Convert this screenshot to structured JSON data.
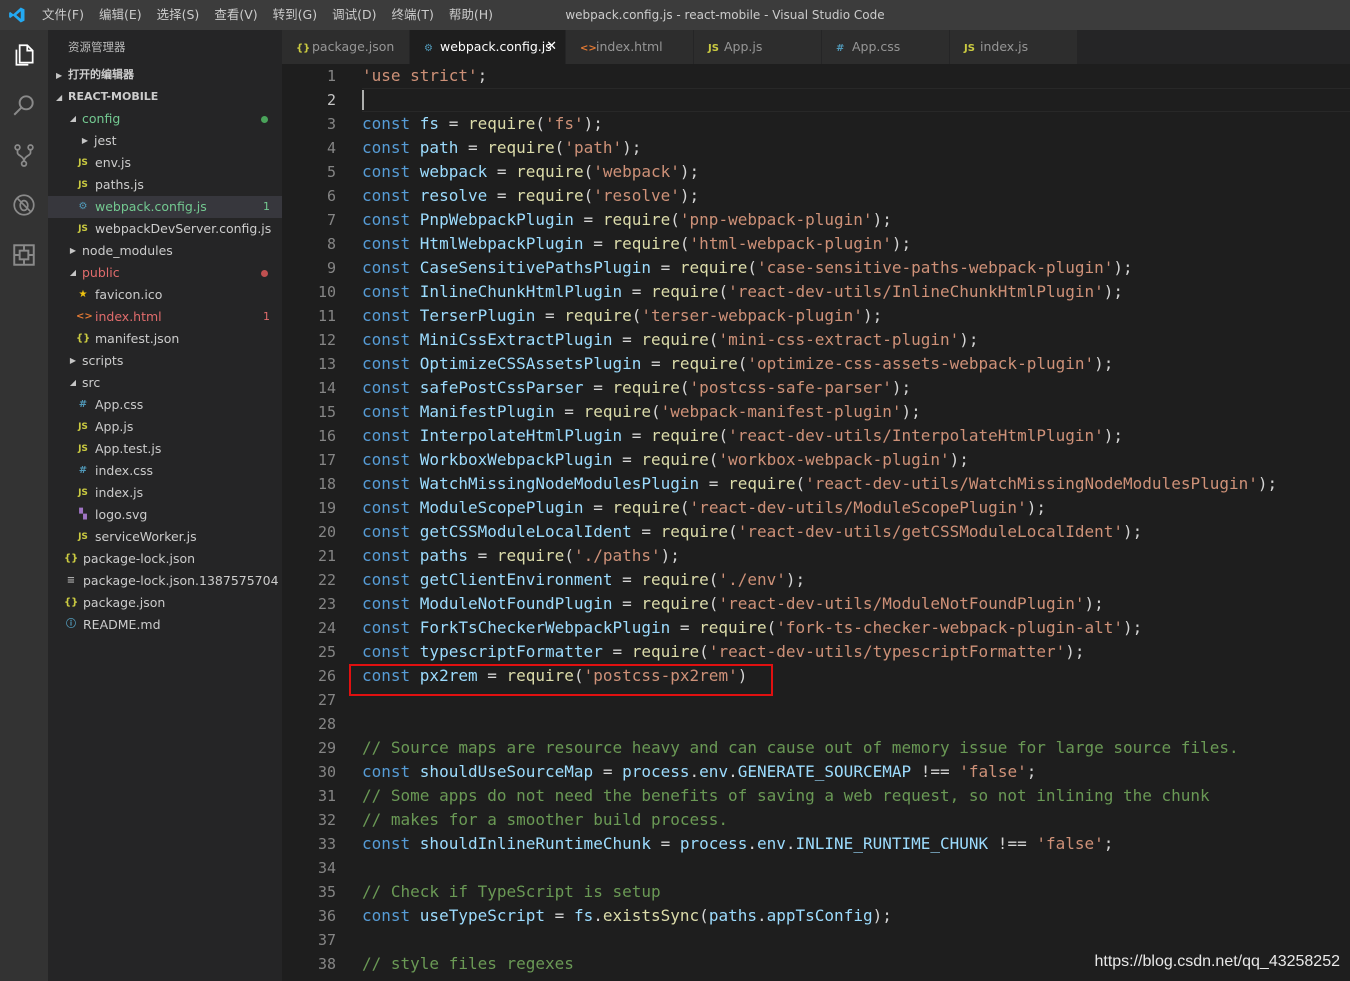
{
  "window": {
    "title": "webpack.config.js - react-mobile - Visual Studio Code",
    "menus": [
      "文件(F)",
      "编辑(E)",
      "选择(S)",
      "查看(V)",
      "转到(G)",
      "调试(D)",
      "终端(T)",
      "帮助(H)"
    ]
  },
  "activity_bar": [
    "explorer-icon",
    "search-icon",
    "source-control-icon",
    "debug-icon",
    "extensions-icon"
  ],
  "sidebar": {
    "title": "资源管理器",
    "sections": {
      "open_editors": "打开的编辑器",
      "project": "REACT-MOBILE"
    },
    "tree": [
      {
        "label": "config",
        "type": "folder",
        "open": true,
        "indent": 1,
        "color": "#73c991",
        "status": "dot-green"
      },
      {
        "label": "jest",
        "type": "folder",
        "open": false,
        "indent": 2
      },
      {
        "label": "env.js",
        "type": "js",
        "indent": 2
      },
      {
        "label": "paths.js",
        "type": "js",
        "indent": 2
      },
      {
        "label": "webpack.config.js",
        "type": "cfg",
        "indent": 2,
        "color": "#73c991",
        "badge": "1",
        "selected": true
      },
      {
        "label": "webpackDevServer.config.js",
        "type": "js",
        "indent": 2
      },
      {
        "label": "node_modules",
        "type": "folder",
        "open": false,
        "indent": 1
      },
      {
        "label": "public",
        "type": "folder",
        "open": true,
        "indent": 1,
        "color": "#e06c6c",
        "status": "dot-red"
      },
      {
        "label": "favicon.ico",
        "type": "star",
        "indent": 2
      },
      {
        "label": "index.html",
        "type": "html",
        "indent": 2,
        "color": "#e06c6c",
        "badge": "1"
      },
      {
        "label": "manifest.json",
        "type": "json",
        "indent": 2
      },
      {
        "label": "scripts",
        "type": "folder",
        "open": false,
        "indent": 1
      },
      {
        "label": "src",
        "type": "folder",
        "open": true,
        "indent": 1
      },
      {
        "label": "App.css",
        "type": "css",
        "indent": 2
      },
      {
        "label": "App.js",
        "type": "js",
        "indent": 2
      },
      {
        "label": "App.test.js",
        "type": "js",
        "indent": 2
      },
      {
        "label": "index.css",
        "type": "css",
        "indent": 2
      },
      {
        "label": "index.js",
        "type": "js",
        "indent": 2
      },
      {
        "label": "logo.svg",
        "type": "svg",
        "indent": 2
      },
      {
        "label": "serviceWorker.js",
        "type": "js",
        "indent": 2
      },
      {
        "label": "package-lock.json",
        "type": "json",
        "indent": 1
      },
      {
        "label": "package-lock.json.1387575704",
        "type": "txt",
        "indent": 1
      },
      {
        "label": "package.json",
        "type": "json",
        "indent": 1
      },
      {
        "label": "README.md",
        "type": "info",
        "indent": 1
      }
    ]
  },
  "tabs": [
    {
      "label": "package.json",
      "icon": "{}",
      "icon_color": "#cbcb41"
    },
    {
      "label": "webpack.config.js",
      "icon": "⚙",
      "icon_color": "#519aba",
      "active": true
    },
    {
      "label": "index.html",
      "icon": "<>",
      "icon_color": "#e37933"
    },
    {
      "label": "App.js",
      "icon": "JS",
      "icon_color": "#cbcb41"
    },
    {
      "label": "App.css",
      "icon": "#",
      "icon_color": "#519aba"
    },
    {
      "label": "index.js",
      "icon": "JS",
      "icon_color": "#cbcb41"
    }
  ],
  "editor": {
    "current_line": 2,
    "highlighted_line": 26,
    "lines": [
      [
        [
          "str",
          "'use strict'"
        ],
        [
          "p",
          ";"
        ]
      ],
      [],
      [
        [
          "kw",
          "const "
        ],
        [
          "id",
          "fs"
        ],
        [
          "p",
          " = "
        ],
        [
          "fn",
          "require"
        ],
        [
          "p",
          "("
        ],
        [
          "str",
          "'fs'"
        ],
        [
          "p",
          ");"
        ]
      ],
      [
        [
          "kw",
          "const "
        ],
        [
          "id",
          "path"
        ],
        [
          "p",
          " = "
        ],
        [
          "fn",
          "require"
        ],
        [
          "p",
          "("
        ],
        [
          "str",
          "'path'"
        ],
        [
          "p",
          ");"
        ]
      ],
      [
        [
          "kw",
          "const "
        ],
        [
          "id",
          "webpack"
        ],
        [
          "p",
          " = "
        ],
        [
          "fn",
          "require"
        ],
        [
          "p",
          "("
        ],
        [
          "str",
          "'webpack'"
        ],
        [
          "p",
          ");"
        ]
      ],
      [
        [
          "kw",
          "const "
        ],
        [
          "id",
          "resolve"
        ],
        [
          "p",
          " = "
        ],
        [
          "fn",
          "require"
        ],
        [
          "p",
          "("
        ],
        [
          "str",
          "'resolve'"
        ],
        [
          "p",
          ");"
        ]
      ],
      [
        [
          "kw",
          "const "
        ],
        [
          "id",
          "PnpWebpackPlugin"
        ],
        [
          "p",
          " = "
        ],
        [
          "fn",
          "require"
        ],
        [
          "p",
          "("
        ],
        [
          "str",
          "'pnp-webpack-plugin'"
        ],
        [
          "p",
          ");"
        ]
      ],
      [
        [
          "kw",
          "const "
        ],
        [
          "id",
          "HtmlWebpackPlugin"
        ],
        [
          "p",
          " = "
        ],
        [
          "fn",
          "require"
        ],
        [
          "p",
          "("
        ],
        [
          "str",
          "'html-webpack-plugin'"
        ],
        [
          "p",
          ");"
        ]
      ],
      [
        [
          "kw",
          "const "
        ],
        [
          "id",
          "CaseSensitivePathsPlugin"
        ],
        [
          "p",
          " = "
        ],
        [
          "fn",
          "require"
        ],
        [
          "p",
          "("
        ],
        [
          "str",
          "'case-sensitive-paths-webpack-plugin'"
        ],
        [
          "p",
          ");"
        ]
      ],
      [
        [
          "kw",
          "const "
        ],
        [
          "id",
          "InlineChunkHtmlPlugin"
        ],
        [
          "p",
          " = "
        ],
        [
          "fn",
          "require"
        ],
        [
          "p",
          "("
        ],
        [
          "str",
          "'react-dev-utils/InlineChunkHtmlPlugin'"
        ],
        [
          "p",
          ");"
        ]
      ],
      [
        [
          "kw",
          "const "
        ],
        [
          "id",
          "TerserPlugin"
        ],
        [
          "p",
          " = "
        ],
        [
          "fn",
          "require"
        ],
        [
          "p",
          "("
        ],
        [
          "str",
          "'terser-webpack-plugin'"
        ],
        [
          "p",
          ");"
        ]
      ],
      [
        [
          "kw",
          "const "
        ],
        [
          "id",
          "MiniCssExtractPlugin"
        ],
        [
          "p",
          " = "
        ],
        [
          "fn",
          "require"
        ],
        [
          "p",
          "("
        ],
        [
          "str",
          "'mini-css-extract-plugin'"
        ],
        [
          "p",
          ");"
        ]
      ],
      [
        [
          "kw",
          "const "
        ],
        [
          "id",
          "OptimizeCSSAssetsPlugin"
        ],
        [
          "p",
          " = "
        ],
        [
          "fn",
          "require"
        ],
        [
          "p",
          "("
        ],
        [
          "str",
          "'optimize-css-assets-webpack-plugin'"
        ],
        [
          "p",
          ");"
        ]
      ],
      [
        [
          "kw",
          "const "
        ],
        [
          "id",
          "safePostCssParser"
        ],
        [
          "p",
          " = "
        ],
        [
          "fn",
          "require"
        ],
        [
          "p",
          "("
        ],
        [
          "str",
          "'postcss-safe-parser'"
        ],
        [
          "p",
          ");"
        ]
      ],
      [
        [
          "kw",
          "const "
        ],
        [
          "id",
          "ManifestPlugin"
        ],
        [
          "p",
          " = "
        ],
        [
          "fn",
          "require"
        ],
        [
          "p",
          "("
        ],
        [
          "str",
          "'webpack-manifest-plugin'"
        ],
        [
          "p",
          ");"
        ]
      ],
      [
        [
          "kw",
          "const "
        ],
        [
          "id",
          "InterpolateHtmlPlugin"
        ],
        [
          "p",
          " = "
        ],
        [
          "fn",
          "require"
        ],
        [
          "p",
          "("
        ],
        [
          "str",
          "'react-dev-utils/InterpolateHtmlPlugin'"
        ],
        [
          "p",
          ");"
        ]
      ],
      [
        [
          "kw",
          "const "
        ],
        [
          "id",
          "WorkboxWebpackPlugin"
        ],
        [
          "p",
          " = "
        ],
        [
          "fn",
          "require"
        ],
        [
          "p",
          "("
        ],
        [
          "str",
          "'workbox-webpack-plugin'"
        ],
        [
          "p",
          ");"
        ]
      ],
      [
        [
          "kw",
          "const "
        ],
        [
          "id",
          "WatchMissingNodeModulesPlugin"
        ],
        [
          "p",
          " = "
        ],
        [
          "fn",
          "require"
        ],
        [
          "p",
          "("
        ],
        [
          "str",
          "'react-dev-utils/WatchMissingNodeModulesPlugin'"
        ],
        [
          "p",
          ");"
        ]
      ],
      [
        [
          "kw",
          "const "
        ],
        [
          "id",
          "ModuleScopePlugin"
        ],
        [
          "p",
          " = "
        ],
        [
          "fn",
          "require"
        ],
        [
          "p",
          "("
        ],
        [
          "str",
          "'react-dev-utils/ModuleScopePlugin'"
        ],
        [
          "p",
          ");"
        ]
      ],
      [
        [
          "kw",
          "const "
        ],
        [
          "id",
          "getCSSModuleLocalIdent"
        ],
        [
          "p",
          " = "
        ],
        [
          "fn",
          "require"
        ],
        [
          "p",
          "("
        ],
        [
          "str",
          "'react-dev-utils/getCSSModuleLocalIdent'"
        ],
        [
          "p",
          ");"
        ]
      ],
      [
        [
          "kw",
          "const "
        ],
        [
          "id",
          "paths"
        ],
        [
          "p",
          " = "
        ],
        [
          "fn",
          "require"
        ],
        [
          "p",
          "("
        ],
        [
          "str",
          "'./paths'"
        ],
        [
          "p",
          ");"
        ]
      ],
      [
        [
          "kw",
          "const "
        ],
        [
          "id",
          "getClientEnvironment"
        ],
        [
          "p",
          " = "
        ],
        [
          "fn",
          "require"
        ],
        [
          "p",
          "("
        ],
        [
          "str",
          "'./env'"
        ],
        [
          "p",
          ");"
        ]
      ],
      [
        [
          "kw",
          "const "
        ],
        [
          "id",
          "ModuleNotFoundPlugin"
        ],
        [
          "p",
          " = "
        ],
        [
          "fn",
          "require"
        ],
        [
          "p",
          "("
        ],
        [
          "str",
          "'react-dev-utils/ModuleNotFoundPlugin'"
        ],
        [
          "p",
          ");"
        ]
      ],
      [
        [
          "kw",
          "const "
        ],
        [
          "id",
          "ForkTsCheckerWebpackPlugin"
        ],
        [
          "p",
          " = "
        ],
        [
          "fn",
          "require"
        ],
        [
          "p",
          "("
        ],
        [
          "str",
          "'fork-ts-checker-webpack-plugin-alt'"
        ],
        [
          "p",
          ");"
        ]
      ],
      [
        [
          "kw",
          "const "
        ],
        [
          "id",
          "typescriptFormatter"
        ],
        [
          "p",
          " = "
        ],
        [
          "fn",
          "require"
        ],
        [
          "p",
          "("
        ],
        [
          "str",
          "'react-dev-utils/typescriptFormatter'"
        ],
        [
          "p",
          ");"
        ]
      ],
      [
        [
          "kw",
          "const "
        ],
        [
          "id",
          "px2rem"
        ],
        [
          "p",
          " = "
        ],
        [
          "fn",
          "require"
        ],
        [
          "p",
          "("
        ],
        [
          "str",
          "'postcss-px2rem'"
        ],
        [
          "p",
          ")"
        ]
      ],
      [],
      [],
      [
        [
          "cm",
          "// Source maps are resource heavy and can cause out of memory issue for large source files."
        ]
      ],
      [
        [
          "kw",
          "const "
        ],
        [
          "id",
          "shouldUseSourceMap"
        ],
        [
          "p",
          " = "
        ],
        [
          "id",
          "process"
        ],
        [
          "p",
          "."
        ],
        [
          "id",
          "env"
        ],
        [
          "p",
          "."
        ],
        [
          "id",
          "GENERATE_SOURCEMAP"
        ],
        [
          "p",
          " !== "
        ],
        [
          "str",
          "'false'"
        ],
        [
          "p",
          ";"
        ]
      ],
      [
        [
          "cm",
          "// Some apps do not need the benefits of saving a web request, so not inlining the chunk"
        ]
      ],
      [
        [
          "cm",
          "// makes for a smoother build process."
        ]
      ],
      [
        [
          "kw",
          "const "
        ],
        [
          "id",
          "shouldInlineRuntimeChunk"
        ],
        [
          "p",
          " = "
        ],
        [
          "id",
          "process"
        ],
        [
          "p",
          "."
        ],
        [
          "id",
          "env"
        ],
        [
          "p",
          "."
        ],
        [
          "id",
          "INLINE_RUNTIME_CHUNK"
        ],
        [
          "p",
          " !== "
        ],
        [
          "str",
          "'false'"
        ],
        [
          "p",
          ";"
        ]
      ],
      [],
      [
        [
          "cm",
          "// Check if TypeScript is setup"
        ]
      ],
      [
        [
          "kw",
          "const "
        ],
        [
          "id",
          "useTypeScript"
        ],
        [
          "p",
          " = "
        ],
        [
          "id",
          "fs"
        ],
        [
          "p",
          "."
        ],
        [
          "fn",
          "existsSync"
        ],
        [
          "p",
          "("
        ],
        [
          "id",
          "paths"
        ],
        [
          "p",
          "."
        ],
        [
          "id",
          "appTsConfig"
        ],
        [
          "p",
          ");"
        ]
      ],
      [],
      [
        [
          "cm",
          "// style files regexes"
        ]
      ]
    ]
  },
  "watermark": "https://blog.csdn.net/qq_43258252"
}
